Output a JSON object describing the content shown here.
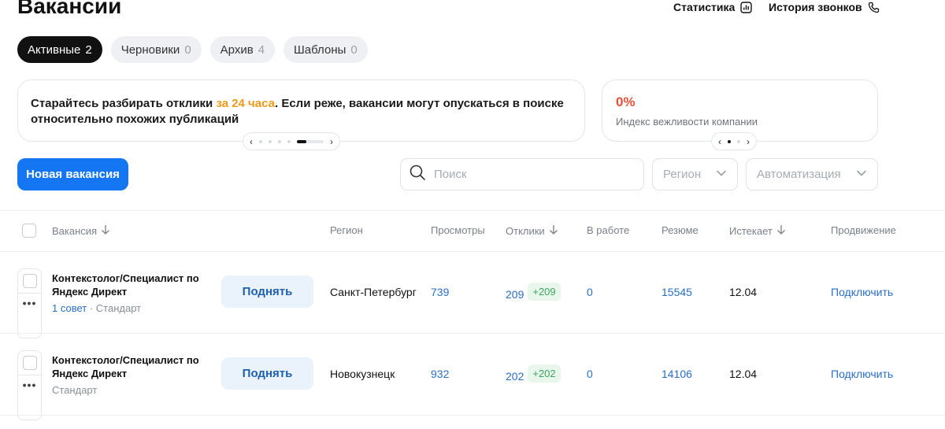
{
  "header": {
    "title": "Вакансии",
    "stats_label": "Статистика",
    "calls_label": "История звонков"
  },
  "tabs": [
    {
      "label": "Активные",
      "count": "2",
      "active": true
    },
    {
      "label": "Черновики",
      "count": "0"
    },
    {
      "label": "Архив",
      "count": "4"
    },
    {
      "label": "Шаблоны",
      "count": "0"
    }
  ],
  "tip_card": {
    "text_before": "Старайтесь разбирать отклики ",
    "highlight": "за 24 часа",
    "text_after": ". Если реже, вакансии могут опускаться в поиске относительно похожих публикаций",
    "highlight_color": "#f09a1b"
  },
  "politeness_card": {
    "value": "0%",
    "label": "Индекс вежливости компании",
    "value_color": "#e8503a"
  },
  "toolbar": {
    "new_vacancy_label": "Новая вакансия",
    "search_placeholder": "Поиск",
    "region_placeholder": "Регион",
    "automation_placeholder": "Автоматизация",
    "accent_color": "#1476f2"
  },
  "table": {
    "columns": {
      "vacancy": "Вакансия",
      "region": "Регион",
      "views": "Просмотры",
      "responses": "Отклики",
      "in_work": "В работе",
      "resume": "Резюме",
      "expires": "Истекает",
      "promotion": "Продвижение"
    },
    "rows": [
      {
        "title": "Контекстолог/Специалист по Яндекс Директ",
        "tips": "1 совет",
        "sep": " · ",
        "tariff": "Стандарт",
        "raise_label": "Поднять",
        "region": "Санкт-Петербург",
        "views": "739",
        "responses": "209",
        "responses_new": "+209",
        "in_work": "0",
        "resume": "15545",
        "expires": "12.04",
        "promotion": "Подключить"
      },
      {
        "title": "Контекстолог/Специалист по Яндекс Директ",
        "tariff": "Стандарт",
        "raise_label": "Поднять",
        "region": "Новокузнецк",
        "views": "932",
        "responses": "202",
        "responses_new": "+202",
        "in_work": "0",
        "resume": "14106",
        "expires": "12.04",
        "promotion": "Подключить"
      }
    ]
  }
}
